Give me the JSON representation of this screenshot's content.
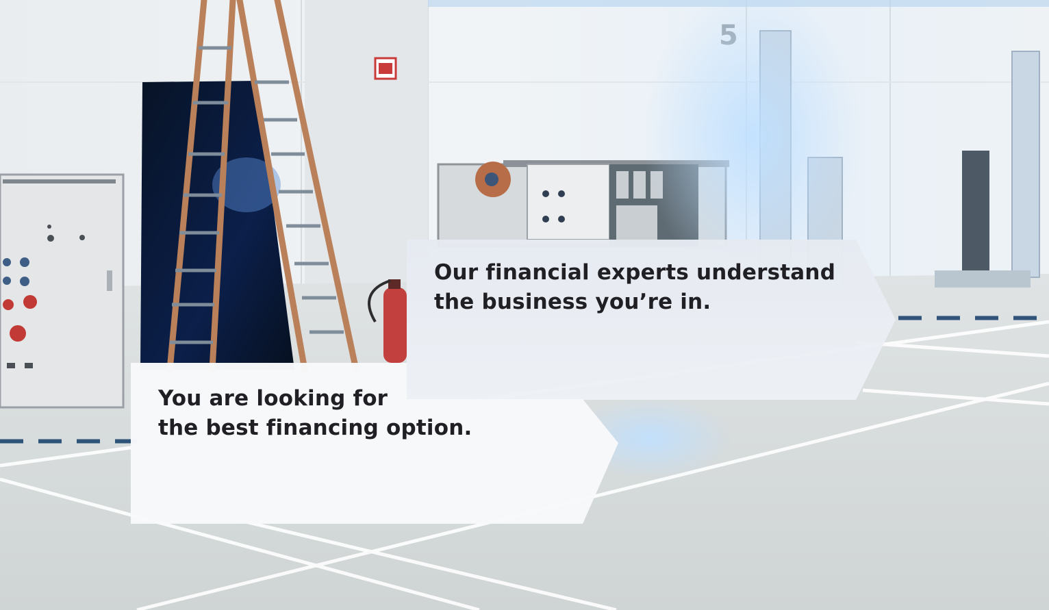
{
  "callouts": {
    "experts": {
      "line1": "Our financial experts understand",
      "line2": "the business you’re in."
    },
    "looking": {
      "line1": "You are looking for",
      "line2": "the best financing option."
    }
  },
  "scene": {
    "sign_number": "5"
  },
  "colors": {
    "callout_fill_top": "#e8ebf1",
    "callout_fill_bottom": "#f7f8fa",
    "dash_color": "#2f5379",
    "text_color": "#1f1f24"
  }
}
